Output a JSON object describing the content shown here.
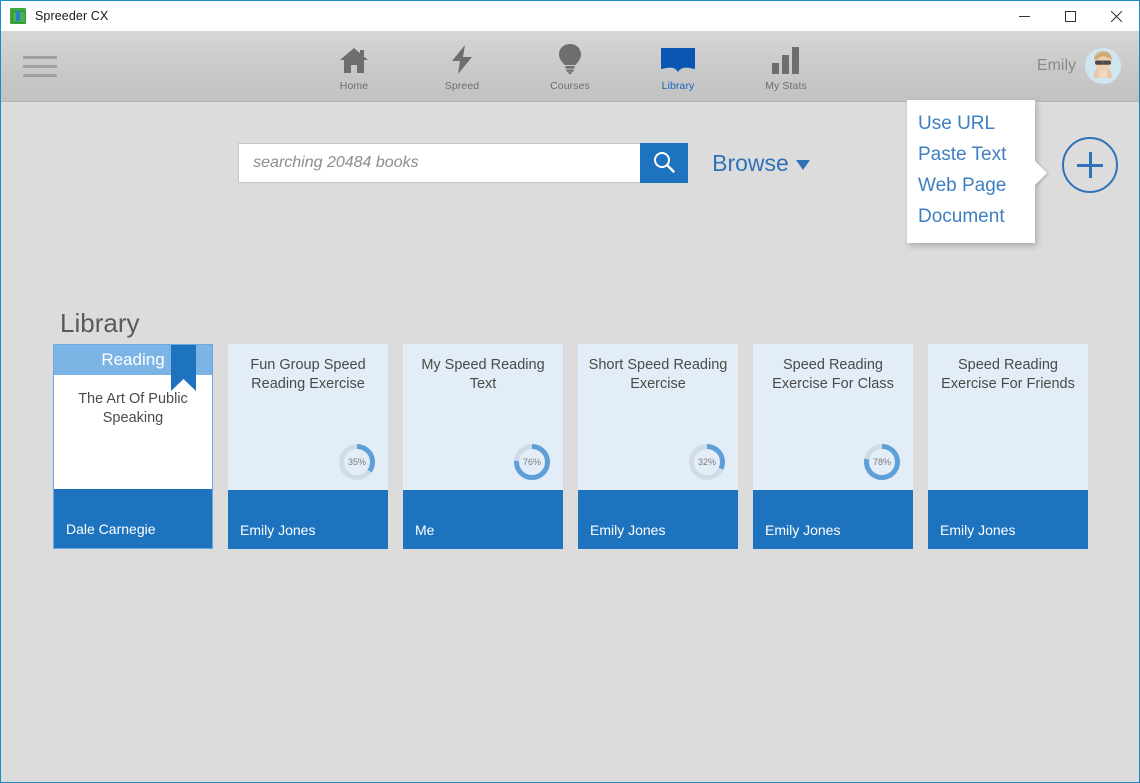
{
  "window": {
    "title": "Spreeder CX",
    "app_icon": "spreeder-logo-icon",
    "controls": {
      "minimize": "minimize-icon",
      "maximize": "maximize-icon",
      "close": "close-icon"
    }
  },
  "nav": {
    "menu_icon": "hamburger-menu-icon",
    "items": [
      {
        "label": "Home",
        "icon": "home-icon",
        "active": false
      },
      {
        "label": "Spreed",
        "icon": "lightning-bolt-icon",
        "active": false
      },
      {
        "label": "Courses",
        "icon": "lightbulb-icon",
        "active": false
      },
      {
        "label": "Library",
        "icon": "open-book-icon",
        "active": true
      },
      {
        "label": "My Stats",
        "icon": "bar-chart-icon",
        "active": false
      }
    ],
    "user": {
      "name": "Emily",
      "avatar": "user-avatar"
    }
  },
  "search": {
    "placeholder": "searching 20484 books",
    "value": "",
    "button_icon": "search-icon",
    "browse_label": "Browse"
  },
  "add_menu": {
    "trigger_icon": "plus-circle-icon",
    "items": [
      {
        "label": "Use URL"
      },
      {
        "label": "Paste Text"
      },
      {
        "label": "Web Page"
      },
      {
        "label": "Document"
      }
    ]
  },
  "library": {
    "heading": "Library",
    "cards": [
      {
        "banner": "Reading",
        "title": "The Art Of Public Speaking",
        "author": "Dale Carnegie",
        "progress": null,
        "reading": true,
        "ribbon": true
      },
      {
        "banner": null,
        "title": "Fun Group Speed Reading Exercise",
        "author": "Emily Jones",
        "progress": 35,
        "progress_label": "35%",
        "reading": false,
        "ribbon": false
      },
      {
        "banner": null,
        "title": "My Speed Reading Text",
        "author": "Me",
        "progress": 76,
        "progress_label": "76%",
        "reading": false,
        "ribbon": false
      },
      {
        "banner": null,
        "title": "Short Speed Reading Exercise",
        "author": "Emily Jones",
        "progress": 32,
        "progress_label": "32%",
        "reading": false,
        "ribbon": false
      },
      {
        "banner": null,
        "title": "Speed Reading Exercise For Class",
        "author": "Emily Jones",
        "progress": 78,
        "progress_label": "78%",
        "reading": false,
        "ribbon": false
      },
      {
        "banner": null,
        "title": "Speed Reading Exercise For Friends",
        "author": "Emily Jones",
        "progress": null,
        "reading": false,
        "ribbon": false
      }
    ]
  },
  "colors": {
    "accent_blue": "#1e73be",
    "link_blue": "#2f72b8",
    "card_bg": "#e3edf7",
    "banner_blue": "#7db4e6",
    "page_bg": "#dcdcdc",
    "nav_bg": "#c9c9c9",
    "window_border": "#1a8ac9"
  }
}
